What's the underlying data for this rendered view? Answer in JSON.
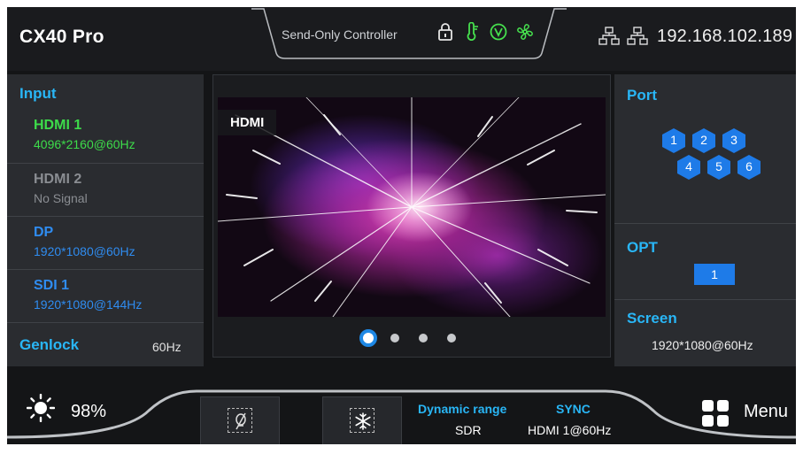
{
  "header": {
    "title": "CX40 Pro",
    "controller_label": "Send-Only Controller",
    "status_icons": [
      "lock-icon",
      "temperature-icon",
      "voltage-icon",
      "fan-icon"
    ],
    "network_icons": [
      "network-icon",
      "network-icon"
    ],
    "ip_address": "192.168.102.189"
  },
  "input": {
    "title": "Input",
    "items": [
      {
        "name": "HDMI 1",
        "signal": "4096*2160@60Hz",
        "color": "#3ddc4a"
      },
      {
        "name": "HDMI 2",
        "signal": "No Signal",
        "color": "#8a8d92"
      },
      {
        "name": "DP",
        "signal": "1920*1080@60Hz",
        "color": "#2f8cf0"
      },
      {
        "name": "SDI 1",
        "signal": "1920*1080@144Hz",
        "color": "#2f8cf0"
      }
    ],
    "genlock_label": "Genlock",
    "genlock_value": "60Hz"
  },
  "preview": {
    "source_tag": "HDMI",
    "pages": 4,
    "active_page": 1
  },
  "port": {
    "title": "Port",
    "ports": [
      "1",
      "2",
      "3",
      "4",
      "5",
      "6"
    ],
    "color": "#1e7be8"
  },
  "opt": {
    "title": "OPT",
    "value": "1"
  },
  "screen": {
    "title": "Screen",
    "resolution": "1920*1080@60Hz"
  },
  "footer": {
    "brightness": "98%",
    "dynamic_range_label": "Dynamic range",
    "dynamic_range_value": "SDR",
    "sync_label": "SYNC",
    "sync_value": "HDMI 1@60Hz",
    "menu_label": "Menu"
  },
  "colors": {
    "accent": "#29b6f6",
    "background": "#141517",
    "panel": "#2a2c30",
    "status_green": "#3ddc4a"
  }
}
